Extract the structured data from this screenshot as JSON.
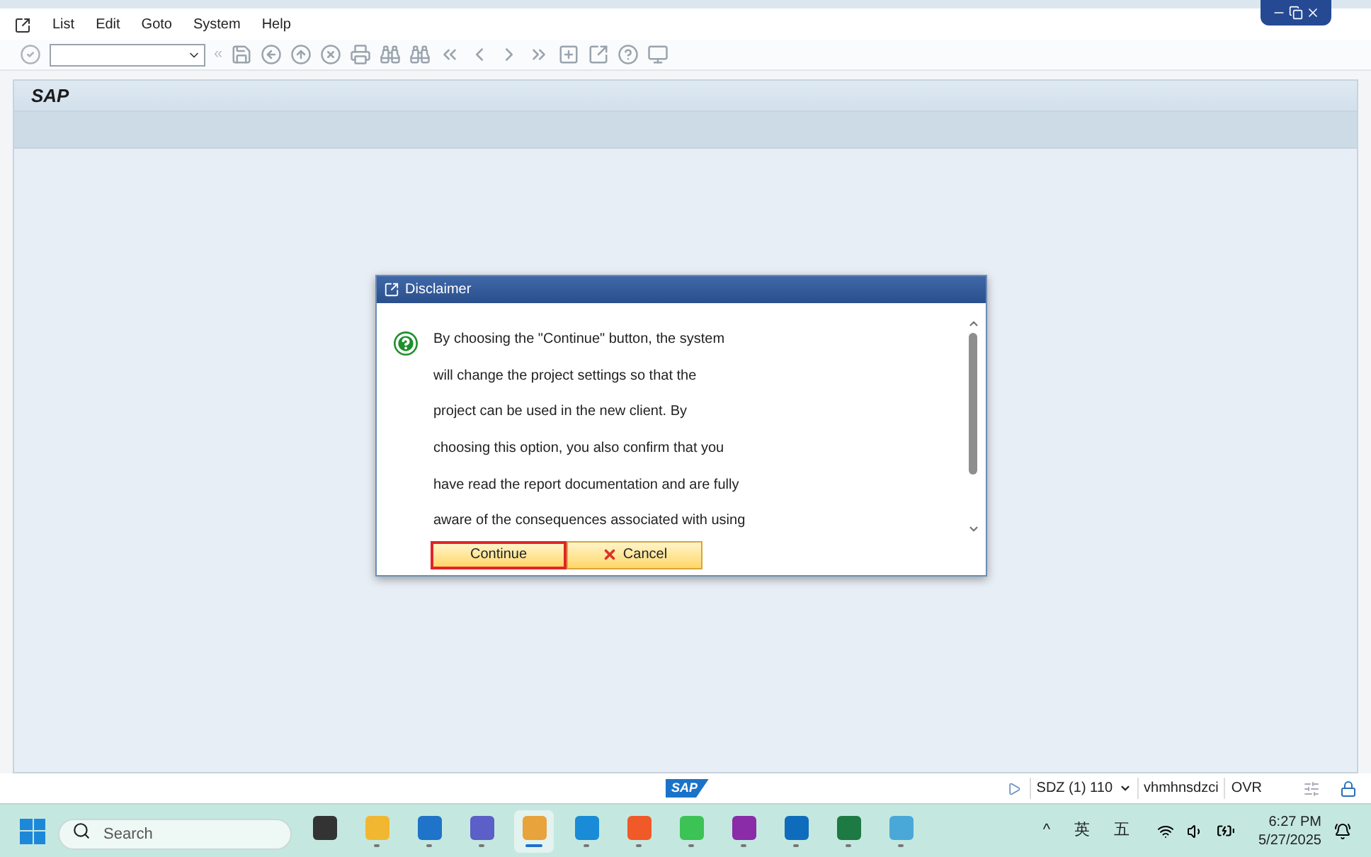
{
  "menu_bar": {
    "items": [
      "List",
      "Edit",
      "Goto",
      "System",
      "Help"
    ]
  },
  "toolbar": {
    "history_mark": "«"
  },
  "title_bar": {
    "title": "SAP"
  },
  "dialog": {
    "title": "Disclaimer",
    "lines": [
      "By choosing the \"Continue\" button, the system",
      "will change the project settings so that the",
      "project can be used in the new client. By",
      "choosing this option, you also confirm that you",
      "have read the report documentation and are fully",
      "aware of the consequences associated with using"
    ],
    "buttons": [
      {
        "label": "Continue",
        "kind": "confirm",
        "highlighted": true
      },
      {
        "label": "Cancel",
        "kind": "cancel",
        "highlighted": false
      }
    ]
  },
  "status_bar": {
    "logo": "SAP",
    "system": "SDZ (1) 110",
    "server": "vhmhnsdzci",
    "mode": "OVR"
  },
  "taskbar": {
    "search": {
      "placeholder": "Search"
    },
    "apps": [
      {
        "color": "#333333",
        "running": false,
        "selected": false
      },
      {
        "color": "#f2b731",
        "running": true,
        "selected": false
      },
      {
        "color": "#1f73c9",
        "running": true,
        "selected": false
      },
      {
        "color": "#5b5fc7",
        "running": true,
        "selected": false
      },
      {
        "color": "#e8a33d",
        "running": true,
        "selected": true
      },
      {
        "color": "#1a8bd6",
        "running": true,
        "selected": false
      },
      {
        "color": "#f05a28",
        "running": true,
        "selected": false
      },
      {
        "color": "#3cc255",
        "running": true,
        "selected": false
      },
      {
        "color": "#8a2ba8",
        "running": true,
        "selected": false
      },
      {
        "color": "#0f6cbd",
        "running": true,
        "selected": false
      },
      {
        "color": "#1d7a42",
        "running": true,
        "selected": false
      },
      {
        "color": "#49a8d8",
        "running": true,
        "selected": false
      }
    ],
    "tray": {
      "chevron": "^",
      "language": "英",
      "input_mode": "五",
      "time": "6:27 PM",
      "date": "5/27/2025"
    }
  }
}
